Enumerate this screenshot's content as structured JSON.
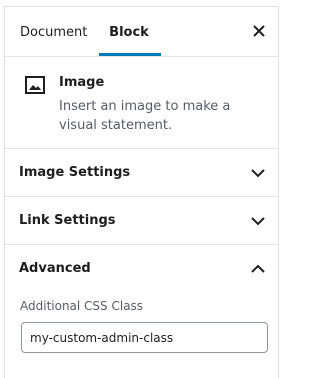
{
  "tabs": {
    "document_label": "Document",
    "block_label": "Block",
    "active": "Block",
    "accent_color": "#007cba"
  },
  "close_icon": "close-icon",
  "block": {
    "icon": "image-icon",
    "title": "Image",
    "description": "Insert an image to make a visual statement."
  },
  "panels": {
    "image_settings": {
      "title": "Image Settings",
      "state": "collapsed",
      "icon": "chevron-down-icon"
    },
    "link_settings": {
      "title": "Link Settings",
      "state": "collapsed",
      "icon": "chevron-down-icon"
    },
    "advanced": {
      "title": "Advanced",
      "state": "expanded",
      "icon": "chevron-up-icon"
    }
  },
  "advanced": {
    "css_class_label": "Additional CSS Class",
    "css_class_value": "my-custom-admin-class"
  }
}
